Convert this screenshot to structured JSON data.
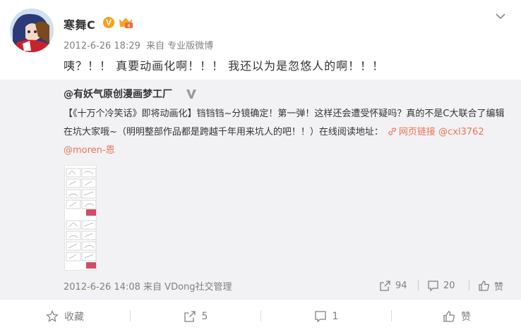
{
  "post": {
    "author": "寒舞C",
    "verified_badge": "V",
    "time": "2012-6-26 18:29",
    "source_prefix": "来自",
    "source": "专业版微博",
    "text": "咦？！！ 真要动画化啊！！！ 我还以为是忽悠人的啊！！！"
  },
  "repost": {
    "author": "@有妖气原创漫画梦工厂",
    "text": "【《十万个冷笑话》即将动画化】铛铛铛~分镜确定！第一弹！这样还会遭受怀疑吗？真的不是C大联合了编辑在坑大家哦~（明明整部作品都是跨越千年用来坑人的吧！！）在线阅读地址：",
    "link_label": "网页链接",
    "mention_1": "@cxl3762",
    "mention_2": "@moren-恩",
    "time": "2012-6-26 14:08",
    "source_prefix": "来自",
    "source": "VDong社交管理",
    "forward_count": "94",
    "comment_count": "20",
    "like_label": "赞"
  },
  "actions": {
    "favorite_label": "收藏",
    "forward_count": "5",
    "comment_count": "1",
    "like_label": "赞"
  },
  "colors": {
    "link": "#eb7350",
    "repost_bg": "#f2f2f5",
    "verified": "#f79f1a",
    "meta_text": "#808080"
  },
  "icons": [
    "avatar",
    "verified-badge-icon",
    "member-badge-icon",
    "chevron-down-icon",
    "verified-gray-icon",
    "link-icon",
    "forward-icon",
    "comment-icon",
    "like-icon",
    "star-icon"
  ]
}
